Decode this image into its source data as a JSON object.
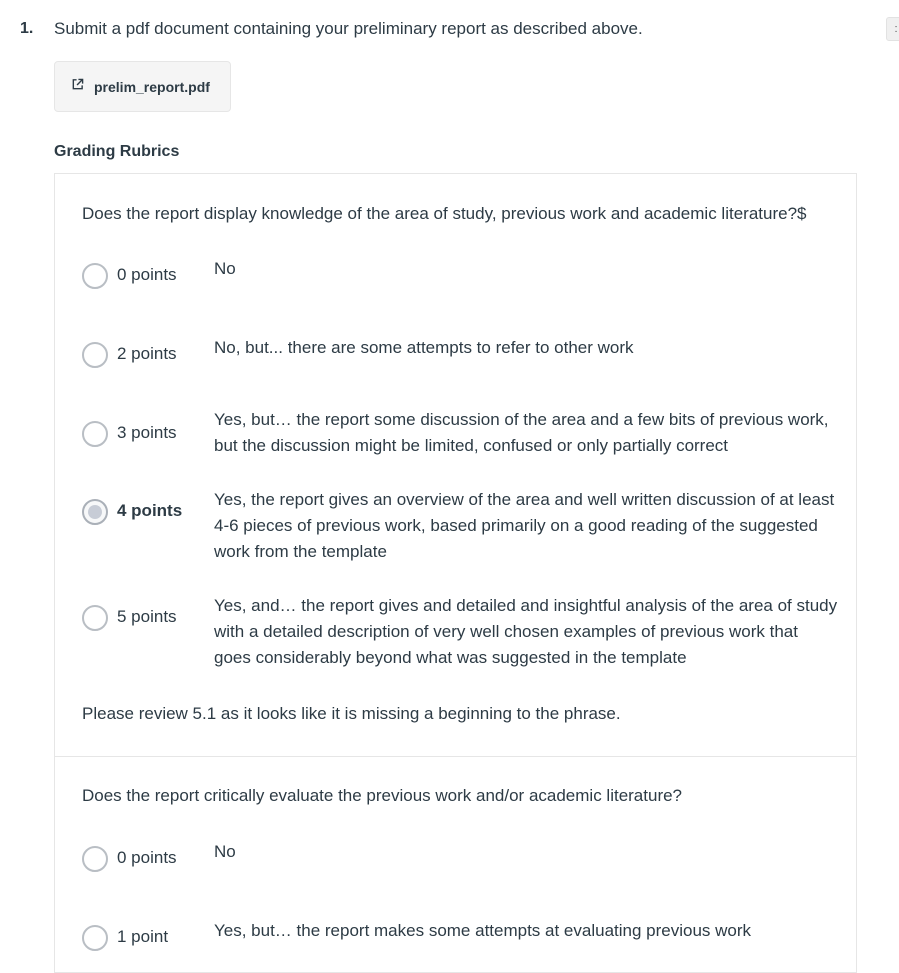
{
  "question": {
    "number": "1.",
    "text": "Submit a pdf document containing your preliminary report as described above.",
    "edge_button_label": ":"
  },
  "attachment": {
    "icon": "external-link-icon",
    "filename": "prelim_report.pdf"
  },
  "rubrics": {
    "title": "Grading Rubrics",
    "criteria": [
      {
        "description": "Does the report display knowledge of the area of study, previous work and academic literature?$",
        "ratings": [
          {
            "points": "0 points",
            "description": "No",
            "selected": false
          },
          {
            "points": "2 points",
            "description": "No, but... there are some attempts to refer to other work",
            "selected": false
          },
          {
            "points": "3 points",
            "description": "Yes, but… the report some discussion of the area and a few bits of previous work, but the discussion might be limited, confused or only partially correct",
            "selected": false
          },
          {
            "points": "4 points",
            "description": "Yes, the report gives an overview of the area and well written discussion of at least 4-6 pieces of previous work, based primarily on a good reading of the suggested work from the template",
            "selected": true
          },
          {
            "points": "5 points",
            "description": "Yes, and… the report gives and detailed and insightful analysis of the area of study with a detailed description of very well chosen examples of previous work that goes considerably beyond what was suggested in the template",
            "selected": false
          }
        ],
        "comment": "Please review 5.1 as it looks like it is missing a beginning to the phrase."
      },
      {
        "description": "Does the report critically evaluate the previous work and/or academic literature?",
        "ratings": [
          {
            "points": "0 points",
            "description": "No",
            "selected": false
          },
          {
            "points": "1 point",
            "description": "Yes, but… the report makes some attempts at evaluating previous work",
            "selected": false
          }
        ]
      }
    ]
  }
}
